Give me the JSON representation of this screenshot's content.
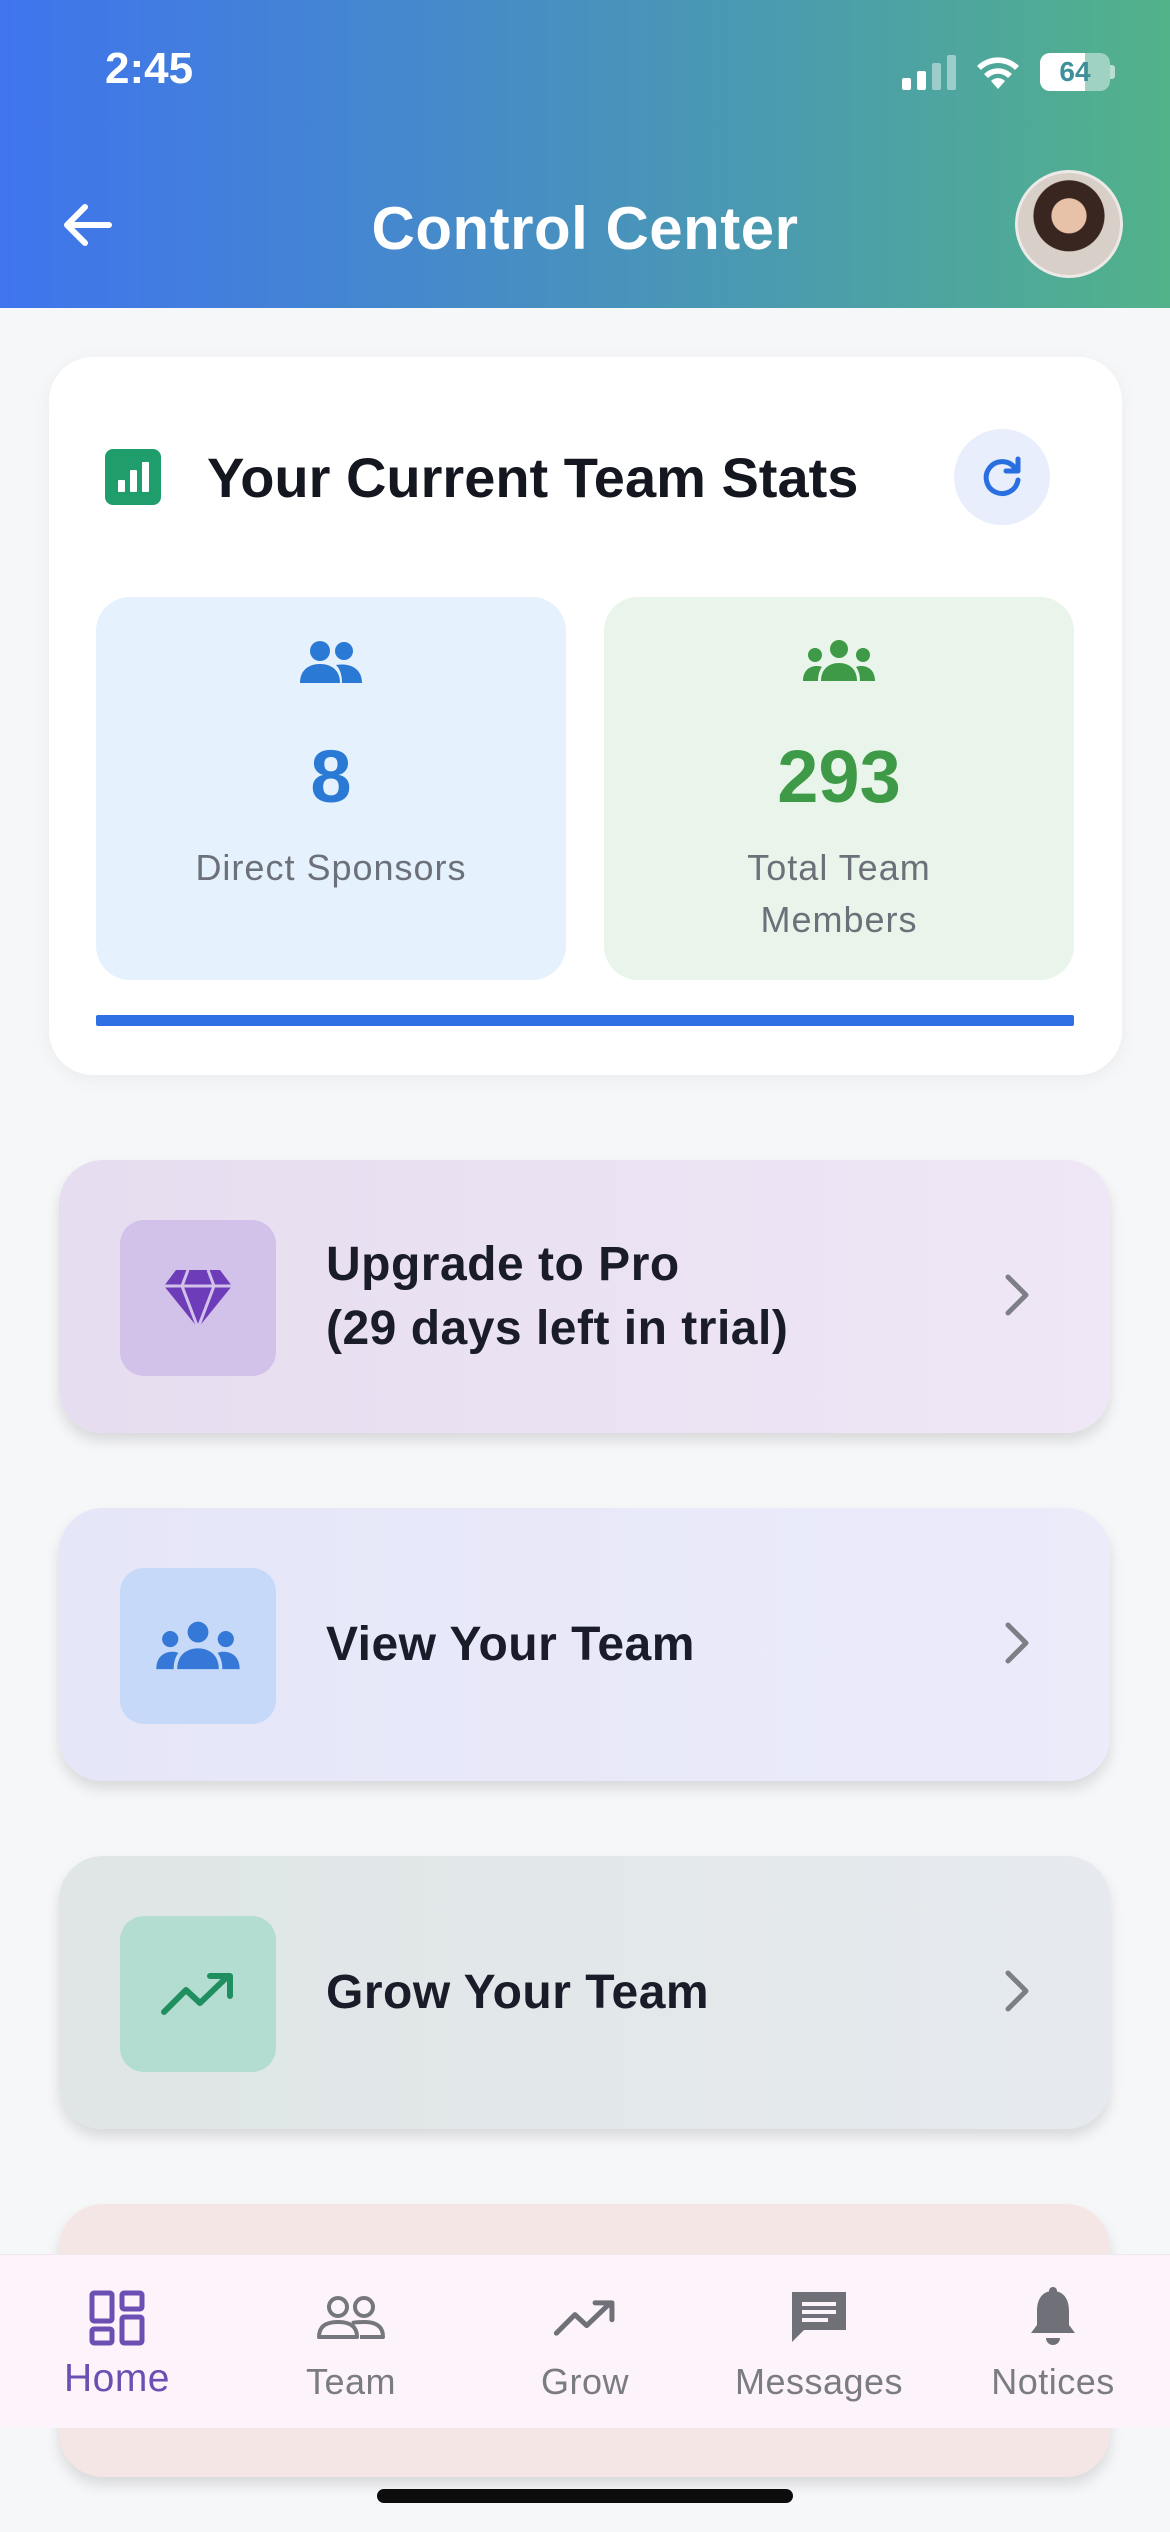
{
  "status_bar": {
    "time": "2:45",
    "battery": "64"
  },
  "header": {
    "title": "Control Center",
    "back_icon": "arrow-left-icon",
    "avatar_icon": "user-avatar"
  },
  "stats": {
    "title": "Your Current Team Stats",
    "icon": "bar-chart-icon",
    "refresh_icon": "refresh-icon",
    "tiles": [
      {
        "value": "8",
        "label": "Direct Sponsors",
        "icon": "people-icon",
        "color": "#2a7ad5"
      },
      {
        "value": "293",
        "label": "Total Team Members",
        "icon": "groups-icon",
        "color": "#3e9a46"
      }
    ],
    "progress": 1.0
  },
  "actions": [
    {
      "label_line1": "Upgrade to Pro",
      "label_line2": "(29 days left in trial)",
      "icon": "diamond-icon"
    },
    {
      "label": "View Your Team",
      "icon": "groups-icon"
    },
    {
      "label": "Grow Your Team",
      "icon": "trending-up-icon"
    }
  ],
  "bottom_nav": [
    {
      "label": "Home",
      "icon": "dashboard-icon",
      "active": true
    },
    {
      "label": "Team",
      "icon": "people-outline-icon",
      "active": false
    },
    {
      "label": "Grow",
      "icon": "trending-up-icon",
      "active": false
    },
    {
      "label": "Messages",
      "icon": "message-icon",
      "active": false
    },
    {
      "label": "Notices",
      "icon": "bell-icon",
      "active": false
    }
  ],
  "colors": {
    "accent": "#2f6fe4",
    "nav_active": "#6b4fb3",
    "header_start": "#3f74ee",
    "header_end": "#52b28a"
  }
}
